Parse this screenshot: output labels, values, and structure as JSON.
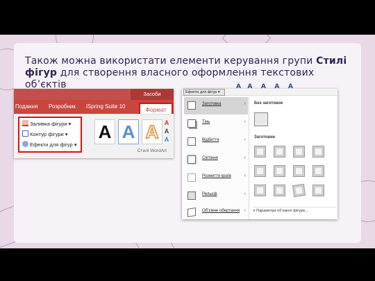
{
  "slide": {
    "title_part1": "Також можна використати елементи керування групи ",
    "title_bold": "Стилі фігур",
    "title_part2": " для створення власного оформлення текстових об’єктів"
  },
  "left_shot": {
    "context_label": "Засоби креслення",
    "tabs": [
      "Подання",
      "Розробник",
      "iSpring Suite 10"
    ],
    "active_tab": "Формат",
    "commands": [
      "Заливка фігури",
      "Контур фігури",
      "Ефекти для фігур"
    ],
    "wordart_letter": "A",
    "group_label": "Стилі WordArt",
    "colors": {
      "ribbon_red": "#c0504d",
      "highlight": "#e01010"
    }
  },
  "right_shot": {
    "effects_button": "Ефекти для фігур",
    "menu_items": [
      "Заготовка",
      "Тінь",
      "Відбиття",
      "Світіння",
      "Розмиття країв",
      "Рельєф",
      "Об’ємне обертання"
    ],
    "selected_item": "Заготовка",
    "no_preset_label": "Без заготовок",
    "presets_label": "Заготовки",
    "options_link": "Параметри об’ємної фігури..."
  }
}
